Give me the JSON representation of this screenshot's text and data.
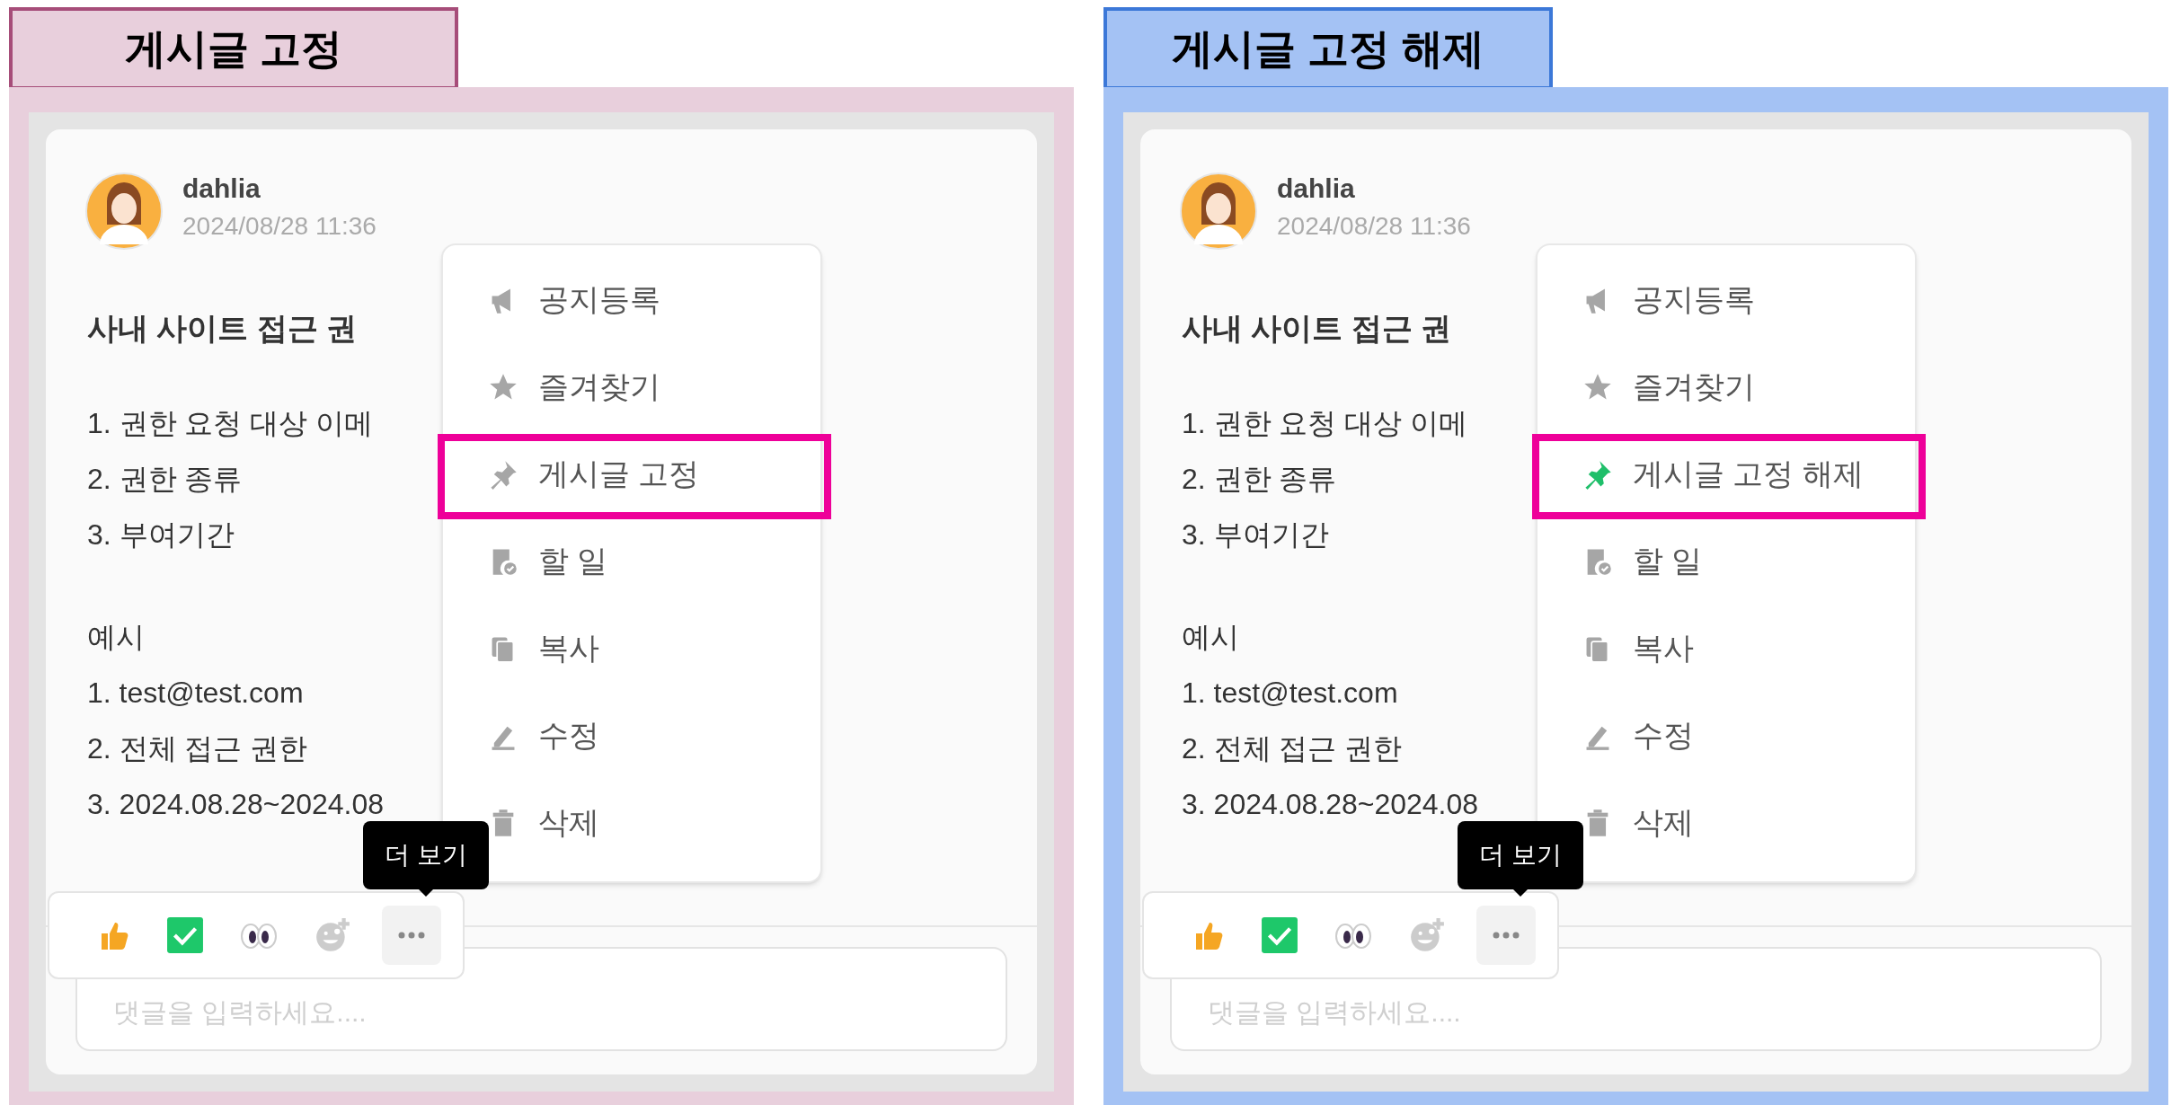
{
  "panels": [
    {
      "kind": "pin",
      "label": "게시글 고정",
      "color": "#e8cfdc",
      "post": {
        "author": "dahlia",
        "time": "2024/08/28 11:36",
        "title": "사내 사이트 접근 권",
        "lines": [
          "1. 권한 요청 대상 이메",
          "2. 권한 종류",
          "3. 부여기간"
        ],
        "example_heading": "예시",
        "example_lines": [
          "1. test@test.com",
          "2. 전체 접근 권한",
          "3. 2024.08.28~2024.08"
        ]
      },
      "menu": [
        {
          "kind": "notice",
          "label": "공지등록",
          "highlighted": false,
          "active": false
        },
        {
          "kind": "favorite",
          "label": "즐겨찾기",
          "highlighted": false,
          "active": false
        },
        {
          "kind": "pin",
          "label": "게시글 고정",
          "highlighted": true,
          "active": false
        },
        {
          "kind": "todo",
          "label": "할 일",
          "highlighted": false,
          "active": false
        },
        {
          "kind": "copy",
          "label": "복사",
          "highlighted": false,
          "active": false
        },
        {
          "kind": "edit",
          "label": "수정",
          "highlighted": false,
          "active": false
        },
        {
          "kind": "delete",
          "label": "삭제",
          "highlighted": false,
          "active": false
        }
      ],
      "tooltip": "더 보기",
      "comment": {
        "placeholder": "댓글을 입력하세요...."
      }
    },
    {
      "kind": "unpin",
      "label": "게시글 고정 해제",
      "color": "#a4c2f4",
      "post": {
        "author": "dahlia",
        "time": "2024/08/28 11:36",
        "title": "사내 사이트 접근 권",
        "lines": [
          "1. 권한 요청 대상 이메",
          "2. 권한 종류",
          "3. 부여기간"
        ],
        "example_heading": "예시",
        "example_lines": [
          "1. test@test.com",
          "2. 전체 접근 권한",
          "3. 2024.08.28~2024.08"
        ]
      },
      "menu": [
        {
          "kind": "notice",
          "label": "공지등록",
          "highlighted": false,
          "active": false
        },
        {
          "kind": "favorite",
          "label": "즐겨찾기",
          "highlighted": false,
          "active": false
        },
        {
          "kind": "pin",
          "label": "게시글 고정 해제",
          "highlighted": true,
          "active": true
        },
        {
          "kind": "todo",
          "label": "할 일",
          "highlighted": false,
          "active": false
        },
        {
          "kind": "copy",
          "label": "복사",
          "highlighted": false,
          "active": false
        },
        {
          "kind": "edit",
          "label": "수정",
          "highlighted": false,
          "active": false
        },
        {
          "kind": "delete",
          "label": "삭제",
          "highlighted": false,
          "active": false
        }
      ],
      "tooltip": "더 보기",
      "comment": {
        "placeholder": "댓글을 입력하세요...."
      }
    }
  ]
}
